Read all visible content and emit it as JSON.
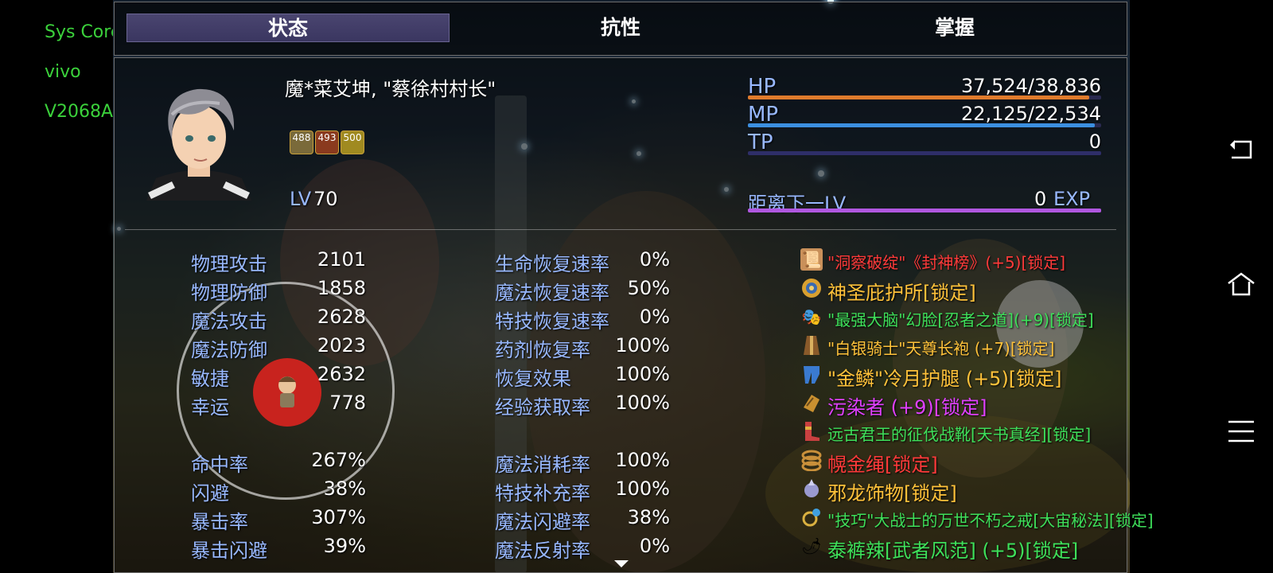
{
  "system_overlay": {
    "line1": "Sys Core",
    "line2": "vivo",
    "line3": "V2068A"
  },
  "tabs": [
    {
      "label": "状态",
      "active": true
    },
    {
      "label": "抗性",
      "active": false
    },
    {
      "label": "掌握",
      "active": false
    }
  ],
  "character": {
    "name": "魔*菜艾坤, \"蔡徐村村长\"",
    "level_label": "LV",
    "level": "70",
    "state_badges": [
      "488",
      "493",
      "500"
    ]
  },
  "gauges": {
    "hp": {
      "label": "HP",
      "value": "37,524/38,836",
      "fraction": 0.966,
      "color": "#e07b2c"
    },
    "mp": {
      "label": "MP",
      "value": "22,125/22,534",
      "fraction": 0.982,
      "color": "#3c8fe0"
    },
    "tp": {
      "label": "TP",
      "value": "0",
      "fraction": 0.0,
      "color": "#3a3a80"
    },
    "exp": {
      "label": "距离下一LV",
      "value": "0",
      "unit": "EXP",
      "fraction": 1.0,
      "color": "#b057e0"
    }
  },
  "stats_left": [
    {
      "label": "物理攻击",
      "value": "2101"
    },
    {
      "label": "物理防御",
      "value": "1858"
    },
    {
      "label": "魔法攻击",
      "value": "2628"
    },
    {
      "label": "魔法防御",
      "value": "2023"
    },
    {
      "label": "敏捷",
      "value": "2632"
    },
    {
      "label": "幸运",
      "value": "778"
    }
  ],
  "stats_left2": [
    {
      "label": "命中率",
      "value": "267%"
    },
    {
      "label": "闪避",
      "value": "38%"
    },
    {
      "label": "暴击率",
      "value": "307%"
    },
    {
      "label": "暴击闪避",
      "value": "39%"
    }
  ],
  "stats_mid": [
    {
      "label": "生命恢复速率",
      "value": "0%"
    },
    {
      "label": "魔法恢复速率",
      "value": "50%"
    },
    {
      "label": "特技恢复速率",
      "value": "0%"
    },
    {
      "label": "药剂恢复率",
      "value": "100%"
    },
    {
      "label": "恢复效果",
      "value": "100%"
    },
    {
      "label": "经验获取率",
      "value": "100%"
    }
  ],
  "stats_mid2": [
    {
      "label": "魔法消耗率",
      "value": "100%"
    },
    {
      "label": "特技补充率",
      "value": "100%"
    },
    {
      "label": "魔法闪避率",
      "value": "38%"
    },
    {
      "label": "魔法反射率",
      "value": "0%"
    }
  ],
  "equipment": [
    {
      "name": "\"洞察破绽\"《封神榜》(+5)[锁定]",
      "color": "#ff3a3a",
      "icon": "scroll-icon",
      "small": true
    },
    {
      "name": "神圣庇护所[锁定]",
      "color": "#ffc23a",
      "icon": "shield-icon",
      "small": false
    },
    {
      "name": "\"最强大脑\"幻脸[忍者之道](+9)[锁定]",
      "color": "#3ee05a",
      "icon": "mask-icon",
      "small": true
    },
    {
      "name": "\"白银骑士\"天尊长袍 (+7)[锁定]",
      "color": "#ffc23a",
      "icon": "robe-icon",
      "small": true
    },
    {
      "name": "\"金鳞\"冷月护腿 (+5)[锁定]",
      "color": "#ffc23a",
      "icon": "leggings-icon",
      "small": false
    },
    {
      "name": "污染者 (+9)[锁定]",
      "color": "#e040ff",
      "icon": "gauntlet-icon",
      "small": false
    },
    {
      "name": "远古君王的征伐战靴[天书真经][锁定]",
      "color": "#3ee05a",
      "icon": "boots-icon",
      "small": true
    },
    {
      "name": "幌金绳[锁定]",
      "color": "#ff3a3a",
      "icon": "rope-icon",
      "small": false
    },
    {
      "name": "邪龙饰物[锁定]",
      "color": "#ffc23a",
      "icon": "ornament-icon",
      "small": false
    },
    {
      "name": "\"技巧\"大战士的万世不朽之戒[大宙秘法][锁定]",
      "color": "#3ee05a",
      "icon": "ring-icon",
      "small": true
    },
    {
      "name": "泰裤辣[武者风范] (+5)[锁定]",
      "color": "#3ee05a",
      "icon": "chili-icon",
      "small": false
    }
  ]
}
